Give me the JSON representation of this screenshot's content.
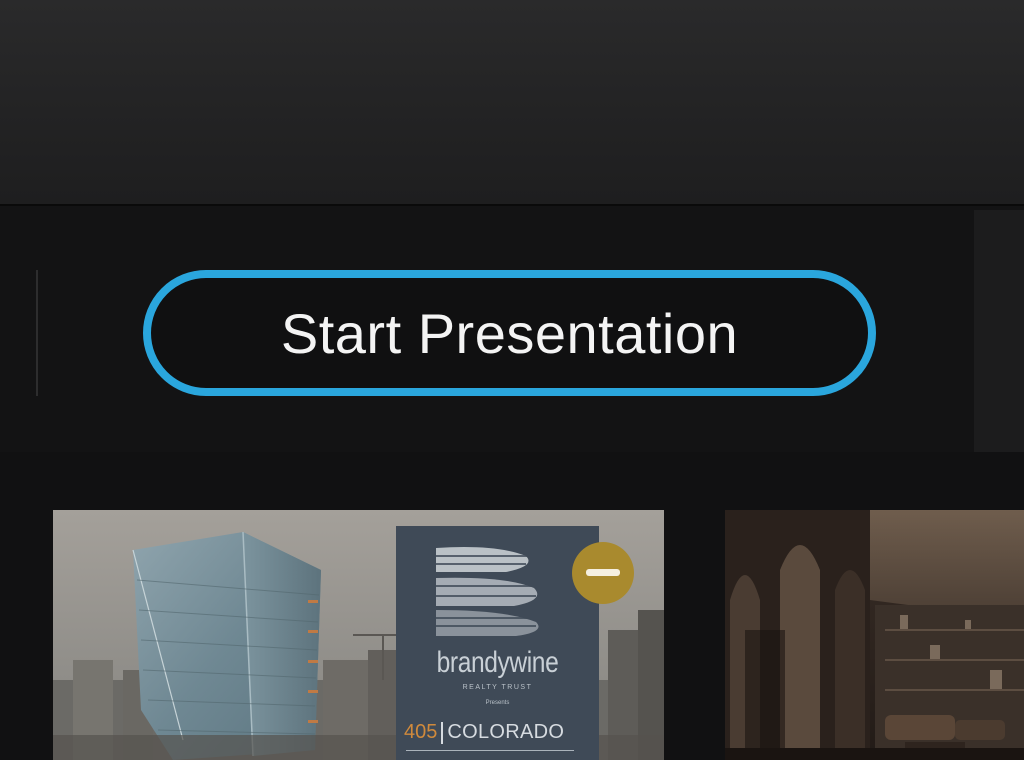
{
  "toolbar": {
    "start_presentation_label": "Start Presentation"
  },
  "thumbnails": [
    {
      "brand": "brandywine",
      "brand_subtitle": "REALTY TRUST",
      "presents": "Presents",
      "address_number": "405",
      "address_street": "COLORADO",
      "badge_icon": "minus-icon"
    },
    {
      "badge_icon": ""
    }
  ],
  "colors": {
    "accent": "#2aa6dd",
    "badge": "#a98a2e",
    "background": "#101010"
  }
}
